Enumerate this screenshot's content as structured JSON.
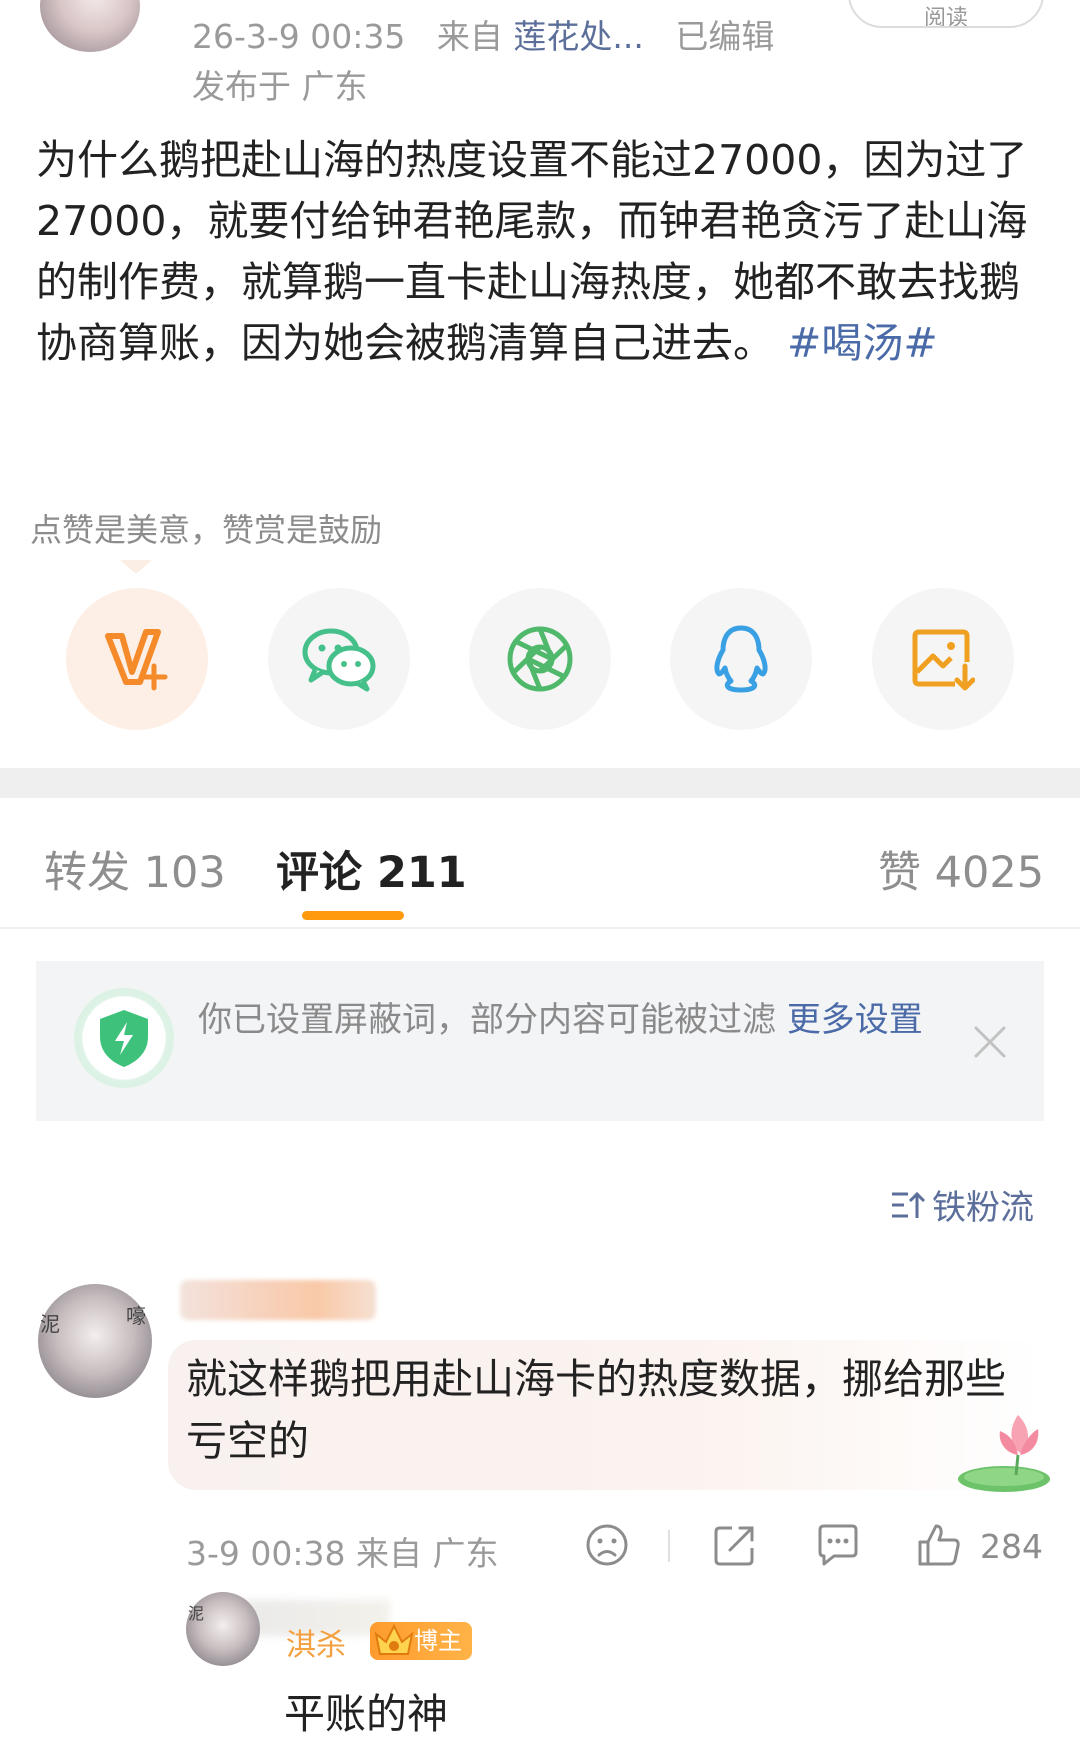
{
  "post": {
    "meta_time": "26-3-9 00:35",
    "meta_from": "来自",
    "meta_source": "莲花处...",
    "meta_edited": "已编辑",
    "meta_location": "发布于 广东",
    "read_label": "阅读",
    "text": "为什么鹅把赴山海的热度设置不能过27000，因为过了27000，就要付给钟君艳尾款，而钟君艳贪污了赴山海的制作费，就算鹅一直卡赴山海热度，她都不敢去找鹅协商算账，因为她会被鹅清算自己进去。",
    "hashtag": "#喝汤#",
    "reward_tip": "点赞是美意，赞赏是鼓励"
  },
  "share": {
    "items": [
      {
        "icon": "v-plus-icon",
        "color": "#f48a2a"
      },
      {
        "icon": "wechat-icon",
        "color": "#45c08a"
      },
      {
        "icon": "moments-icon",
        "color": "#4fb86a"
      },
      {
        "icon": "qq-icon",
        "color": "#3aa0e4"
      },
      {
        "icon": "save-image-icon",
        "color": "#f0a020"
      }
    ]
  },
  "tabs": {
    "repost": "转发 103",
    "comments": "评论 211",
    "likes": "赞 4025"
  },
  "notice": {
    "text": "你已设置屏蔽词，部分内容可能被过滤",
    "link": "更多设置"
  },
  "sort": {
    "label": "铁粉流"
  },
  "comment": {
    "avatar_tag_left": "泥",
    "avatar_tag_right": "嚎",
    "text": "就这样鹅把用赴山海卡的热度数据，挪给那些亏空的",
    "time": "3-9 00:38",
    "from": "来自 广东",
    "like_count": "284"
  },
  "reply": {
    "avatar_tag": "泥",
    "name": "淇杀",
    "badge": "博主",
    "text": "平账的神"
  },
  "colors": {
    "accent": "#ff9a0f",
    "link": "#4a6aa8"
  }
}
